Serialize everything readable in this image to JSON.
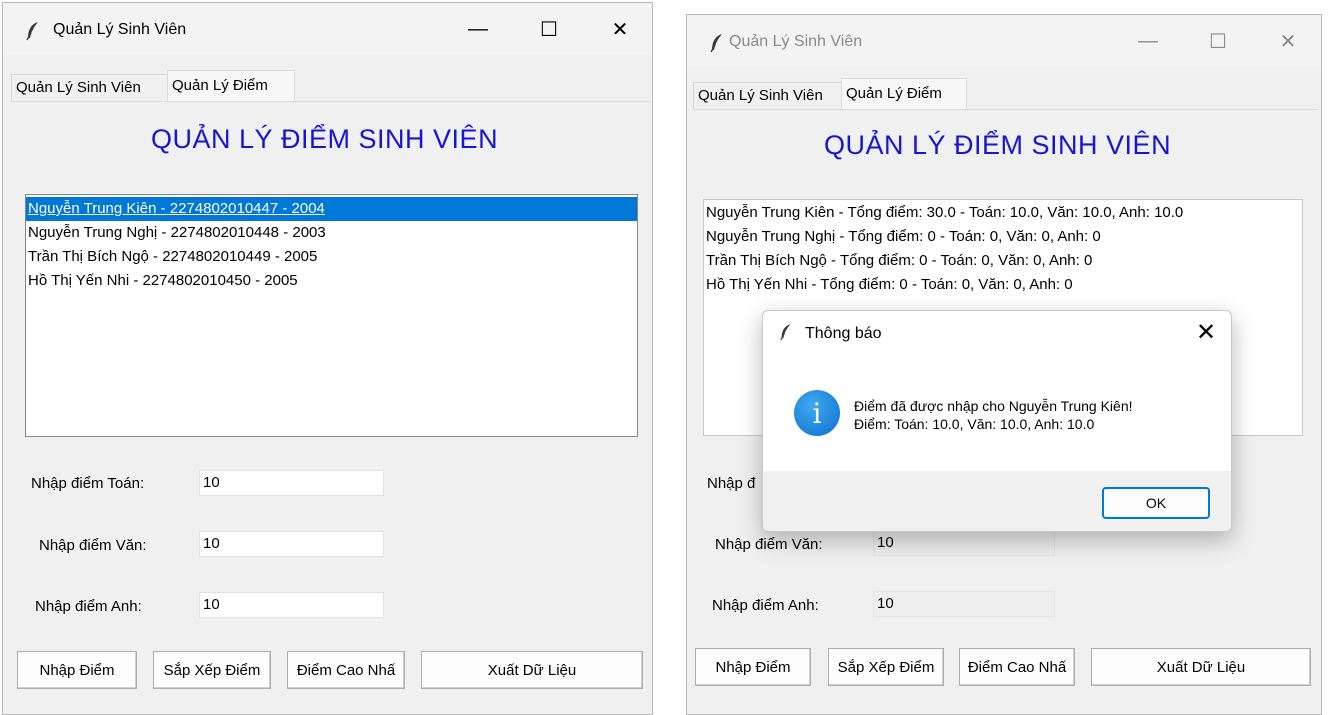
{
  "left_window": {
    "title": "Quản Lý Sinh Viên",
    "controls": {
      "minimize": "—",
      "maximize": "☐",
      "close": "✕"
    },
    "tabs": [
      {
        "label": "Quản Lý Sinh Viên",
        "selected": false
      },
      {
        "label": "Quản Lý Điểm",
        "selected": true
      }
    ],
    "heading": "QUẢN LÝ ĐIỂM SINH VIÊN",
    "list_items": [
      "Nguyễn Trung Kiên - 2274802010447 - 2004",
      "Nguyễn Trung Nghị  - 2274802010448 - 2003",
      "Trần Thị Bích Ngộ  - 2274802010449 - 2005",
      "Hồ Thị Yến Nhi - 2274802010450 - 2005"
    ],
    "selected_index": 0,
    "fields": [
      {
        "label": "Nhập điểm Toán:",
        "value": "10"
      },
      {
        "label": "Nhập điểm Văn:",
        "value": "10"
      },
      {
        "label": "Nhập điểm Anh:",
        "value": "10"
      }
    ],
    "buttons": [
      "Nhập Điểm",
      "Sắp Xếp Điểm",
      "Điểm Cao Nhấ",
      "Xuất Dữ Liệu"
    ]
  },
  "right_window": {
    "title": "Quản Lý Sinh Viên",
    "controls": {
      "minimize": "—",
      "maximize": "☐",
      "close": "✕"
    },
    "tabs": [
      {
        "label": "Quản Lý Sinh Viên",
        "selected": false
      },
      {
        "label": "Quản Lý Điểm",
        "selected": true
      }
    ],
    "heading": "QUẢN LÝ ĐIỂM SINH VIÊN",
    "list_items": [
      "Nguyễn Trung Kiên - Tổng điểm: 30.0 - Toán: 10.0, Văn: 10.0, Anh: 10.0",
      "Nguyễn Trung Nghị  - Tổng điểm: 0 - Toán: 0, Văn: 0, Anh: 0",
      "Trần Thị Bích Ngộ  - Tổng điểm: 0 - Toán: 0, Văn: 0, Anh: 0",
      "Hồ Thị Yến Nhi - Tổng điểm: 0 - Toán: 0, Văn: 0, Anh: 0"
    ],
    "fields": [
      {
        "label": "Nhập đ",
        "value": ""
      },
      {
        "label": "Nhập điểm Văn:",
        "value": "10"
      },
      {
        "label": "Nhập điểm Anh:",
        "value": "10"
      }
    ],
    "buttons": [
      "Nhập Điểm",
      "Sắp Xếp Điểm",
      "Điểm Cao Nhấ",
      "Xuất Dữ Liệu"
    ]
  },
  "dialog": {
    "title": "Thông báo",
    "close": "✕",
    "icon": "info-icon",
    "icon_glyph": "i",
    "message_line1": "Điểm đã được nhập cho Nguyễn Trung Kiên!",
    "message_line2": "Điểm: Toán: 10.0, Văn: 10.0, Anh: 10.0",
    "ok_label": "OK"
  },
  "colors": {
    "heading": "#1515d6",
    "selection": "#0078d7",
    "window_bg": "#f0f0f0"
  }
}
